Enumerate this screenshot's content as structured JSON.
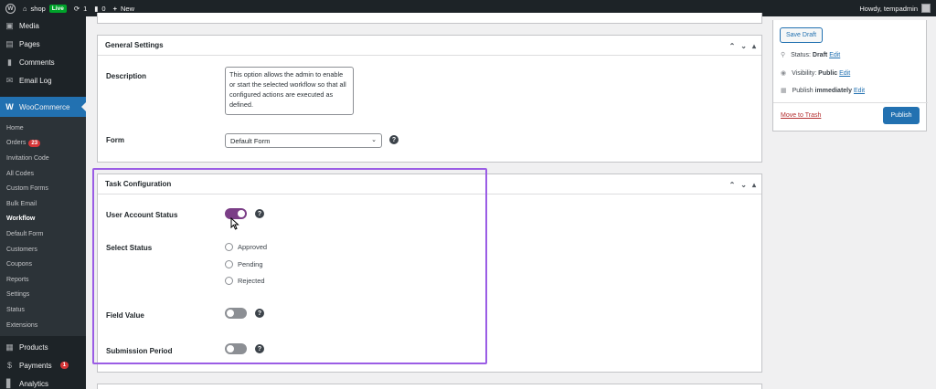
{
  "adminbar": {
    "site_name": "shop",
    "live_badge": "Live",
    "updates_count": "1",
    "comments_count": "0",
    "new_label": "New",
    "howdy": "Howdy, tempadmin"
  },
  "sidebar": {
    "top_items": [
      {
        "label": "Media",
        "icon": "media-icon"
      },
      {
        "label": "Pages",
        "icon": "pages-icon"
      },
      {
        "label": "Comments",
        "icon": "comments-icon"
      },
      {
        "label": "Email Log",
        "icon": "email-icon"
      }
    ],
    "woocommerce": "WooCommerce",
    "submenu": [
      "Home",
      "Orders",
      "Invitation Code",
      "All Codes",
      "Custom Forms",
      "Bulk Email",
      "Workflow",
      "Default Form",
      "Customers",
      "Coupons",
      "Reports",
      "Settings",
      "Status",
      "Extensions"
    ],
    "orders_badge": "23",
    "bottom_items": [
      {
        "label": "Products",
        "icon": "products-icon"
      },
      {
        "label": "Payments",
        "icon": "payments-icon",
        "badge": "1"
      },
      {
        "label": "Analytics",
        "icon": "analytics-icon"
      }
    ]
  },
  "general_settings": {
    "title": "General Settings",
    "description_label": "Description",
    "description_value": "This option allows the admin to enable or start the selected workflow so that all configured actions are executed as defined.",
    "form_label": "Form",
    "form_value": "Default Form"
  },
  "task_configuration": {
    "title": "Task Configuration",
    "user_account_status_label": "User Account Status",
    "user_account_status_on": true,
    "select_status_label": "Select Status",
    "status_options": [
      "Approved",
      "Pending",
      "Rejected"
    ],
    "field_value_label": "Field Value",
    "field_value_on": false,
    "submission_period_label": "Submission Period",
    "submission_period_on": false
  },
  "publish": {
    "save_draft": "Save Draft",
    "status_label": "Status:",
    "status_value": "Draft",
    "visibility_label": "Visibility:",
    "visibility_value": "Public",
    "publish_label": "Publish",
    "publish_value": "immediately",
    "edit": "Edit",
    "move_to_trash": "Move to Trash",
    "publish_button": "Publish"
  },
  "colors": {
    "accent": "#2271b1",
    "toggle_on": "#7b3e87",
    "highlight": "#9b5de5"
  }
}
